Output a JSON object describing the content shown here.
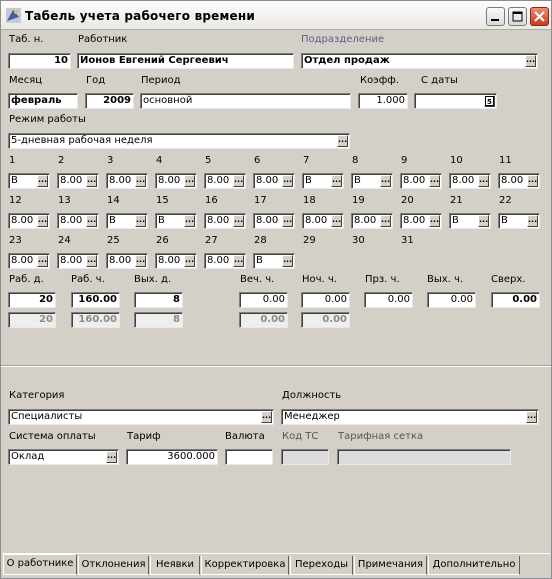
{
  "window": {
    "title": "Табель учета рабочего времени",
    "controls": [
      "minimize-icon",
      "maximize-icon",
      "close-icon"
    ],
    "close_color": "#d8442c"
  },
  "header": {
    "tab_no_label": "Таб. н.",
    "tab_no_value": "10",
    "employee_label": "Работник",
    "employee_value": "Ионов Евгений Сергеевич",
    "department_label": "Подразделение",
    "department_value": "Отдел продаж",
    "month_label": "Месяц",
    "month_value": "февраль",
    "year_label": "Год",
    "year_value": "2009",
    "period_label": "Период",
    "period_value": "основной",
    "coef_label": "Коэфф.",
    "coef_value": "1.000",
    "from_date_label": "С даты",
    "from_date_value": "",
    "mode_label": "Режим работы",
    "mode_value": "5-дневная рабочая неделя",
    "dd_glyph": "..."
  },
  "days": [
    {
      "n": "1",
      "v": "В"
    },
    {
      "n": "2",
      "v": "8.00"
    },
    {
      "n": "3",
      "v": "8.00"
    },
    {
      "n": "4",
      "v": "8.00"
    },
    {
      "n": "5",
      "v": "8.00"
    },
    {
      "n": "6",
      "v": "8.00"
    },
    {
      "n": "7",
      "v": "В"
    },
    {
      "n": "8",
      "v": "В"
    },
    {
      "n": "9",
      "v": "8.00"
    },
    {
      "n": "10",
      "v": "8.00"
    },
    {
      "n": "11",
      "v": "8.00"
    },
    {
      "n": "12",
      "v": "8.00"
    },
    {
      "n": "13",
      "v": "8.00"
    },
    {
      "n": "14",
      "v": "В"
    },
    {
      "n": "15",
      "v": "В"
    },
    {
      "n": "16",
      "v": "8.00"
    },
    {
      "n": "17",
      "v": "8.00"
    },
    {
      "n": "18",
      "v": "8.00"
    },
    {
      "n": "19",
      "v": "8.00"
    },
    {
      "n": "20",
      "v": "8.00"
    },
    {
      "n": "21",
      "v": "В"
    },
    {
      "n": "22",
      "v": "В"
    },
    {
      "n": "23",
      "v": "8.00"
    },
    {
      "n": "24",
      "v": "8.00"
    },
    {
      "n": "25",
      "v": "8.00"
    },
    {
      "n": "26",
      "v": "8.00"
    },
    {
      "n": "27",
      "v": "8.00"
    },
    {
      "n": "28",
      "v": "В"
    },
    {
      "n": "29",
      "v": ""
    },
    {
      "n": "30",
      "v": ""
    },
    {
      "n": "31",
      "v": ""
    }
  ],
  "totals": {
    "work_days_label": "Раб. д.",
    "work_hours_label": "Раб. ч.",
    "off_days_label": "Вых. д.",
    "evening_label": "Веч. ч.",
    "night_label": "Ноч. ч.",
    "holiday_label": "Прз. ч.",
    "weekend_hours_label": "Вых. ч.",
    "overtime_label": "Сверх.",
    "row1": {
      "work_days": "20",
      "work_hours": "160.00",
      "off_days": "8",
      "evening": "0.00",
      "night": "0.00",
      "holiday": "0.00",
      "weekend_hours": "0.00",
      "overtime": "0.00"
    },
    "row2": {
      "work_days": "20",
      "work_hours": "160.00",
      "off_days": "8",
      "evening": "0.00",
      "night": "0.00"
    }
  },
  "employee": {
    "category_label": "Категория",
    "category_value": "Специалисты",
    "position_label": "Должность",
    "position_value": "Менеджер",
    "pay_system_label": "Система оплаты",
    "pay_system_value": "Оклад",
    "tariff_label": "Тариф",
    "tariff_value": "3600.000",
    "currency_label": "Валюта",
    "currency_value": "",
    "ts_code_label": "Код ТС",
    "ts_code_value": "",
    "tariff_grid_label": "Тарифная сетка",
    "tariff_grid_value": ""
  },
  "tabs": [
    "О работнике",
    "Отклонения",
    "Неявки",
    "Корректировка",
    "Переходы",
    "Примечания",
    "Дополнительно"
  ]
}
